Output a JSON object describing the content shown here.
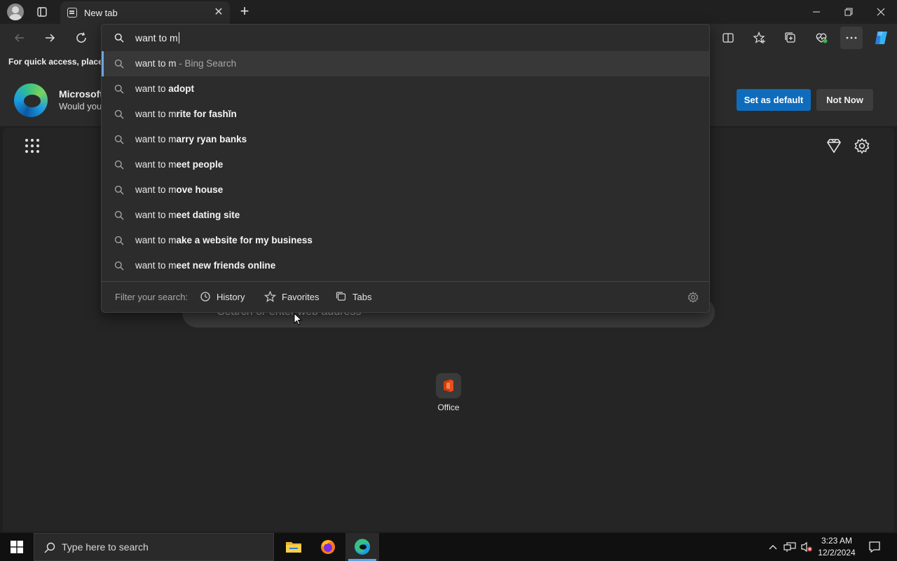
{
  "window": {
    "tab_title": "New tab",
    "tab_close": "✕",
    "new_tab": "+"
  },
  "address_bar": {
    "typed_text": "want to m",
    "suggestions": [
      {
        "prefix": "want to m",
        "bold": "",
        "hint": " - Bing Search",
        "selected": true
      },
      {
        "prefix": "want to ",
        "bold": "adopt",
        "hint": ""
      },
      {
        "prefix": "want to m",
        "bold": "rite for fashĭn",
        "hint": ""
      },
      {
        "prefix": "want to m",
        "bold": "arry ryan banks",
        "hint": ""
      },
      {
        "prefix": "want to m",
        "bold": "eet people",
        "hint": ""
      },
      {
        "prefix": "want to m",
        "bold": "ove house",
        "hint": ""
      },
      {
        "prefix": "want to m",
        "bold": "eet dating site",
        "hint": ""
      },
      {
        "prefix": "want to m",
        "bold": "ake a website for my business",
        "hint": ""
      },
      {
        "prefix": "want to m",
        "bold": "eet new friends online",
        "hint": ""
      }
    ],
    "filter_label": "Filter your search:",
    "filters": [
      "History",
      "Favorites",
      "Tabs"
    ]
  },
  "favorites_bar": {
    "hint": "For quick access, place y"
  },
  "banner": {
    "title": "Microsoft",
    "subtitle": "Would you",
    "set_default": "Set as default",
    "not_now": "Not Now"
  },
  "new_tab_page": {
    "search_placeholder": "Search or enter web address",
    "tile_label": "Office"
  },
  "taskbar": {
    "search_placeholder": "Type here to search",
    "time": "3:23 AM",
    "date": "12/2/2024"
  },
  "colors": {
    "accent": "#0f6cbd",
    "background": "#1f1f1f",
    "panel": "#2c2c2c"
  }
}
